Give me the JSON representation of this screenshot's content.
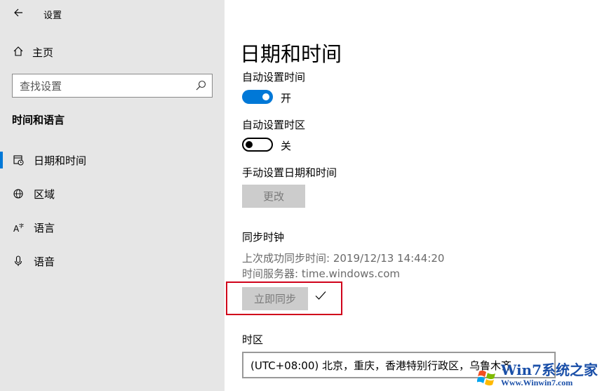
{
  "window": {
    "title": "设置"
  },
  "sidebar": {
    "home_label": "主页",
    "search_placeholder": "查找设置",
    "section_title": "时间和语言",
    "items": [
      {
        "label": "日期和时间",
        "icon": "calendar-clock-icon",
        "active": true
      },
      {
        "label": "区域",
        "icon": "globe-icon",
        "active": false
      },
      {
        "label": "语言",
        "icon": "language-icon",
        "active": false
      },
      {
        "label": "语音",
        "icon": "microphone-icon",
        "active": false
      }
    ]
  },
  "main": {
    "title": "日期和时间",
    "auto_time": {
      "label": "自动设置时间",
      "state": "开",
      "on": true
    },
    "auto_timezone": {
      "label": "自动设置时区",
      "state": "关",
      "on": false
    },
    "manual": {
      "label": "手动设置日期和时间",
      "button": "更改"
    },
    "sync": {
      "label": "同步时钟",
      "last_sync": "上次成功同步时间: 2019/12/13 14:44:20",
      "server": "时间服务器: time.windows.com",
      "button": "立即同步",
      "status_icon": "checkmark-icon"
    },
    "timezone": {
      "label": "时区",
      "value": "(UTC+08:00) 北京，重庆，香港特别行政区，乌鲁木齐"
    }
  },
  "watermark": {
    "brand": "Win7系统之家",
    "url": "Www.Winwin7.com"
  },
  "colors": {
    "accent": "#0078d7",
    "sidebar_bg": "#e6e6e6",
    "highlight": "#d0021b"
  }
}
